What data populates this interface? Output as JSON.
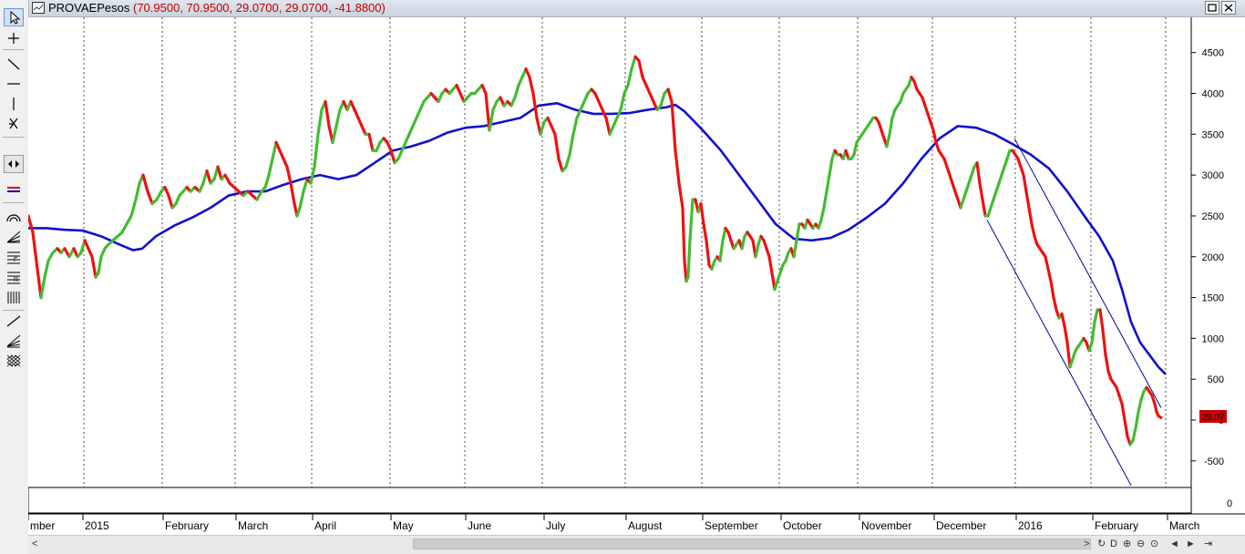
{
  "window": {
    "title": "PROVAEPesos",
    "values": "(70.9500, 70.9500, 29.0700, 29.0700, -41.8800)"
  },
  "toolbar": {
    "tools": [
      "select-tool",
      "crosshair-tool",
      "trendline-tool",
      "horizontal-line-tool",
      "vertical-line-tool",
      "cross-lines-tool",
      "scroll-tool",
      "indicator-tool",
      "arc-tool",
      "fan-tool",
      "fibonacci-tool",
      "fib-retracement-tool",
      "time-cycles-tool",
      "line-tool",
      "speed-lines-tool",
      "grid-tool"
    ]
  },
  "scrollbar": {
    "left_arrow": "<",
    "right_arrow": ">",
    "buttons": [
      "↻",
      "D",
      "⊕",
      "⊖",
      "⊙",
      "◄",
      "►",
      "⇥"
    ]
  },
  "colors": {
    "up": "#44bb33",
    "down": "#ee1111",
    "ma": "#1010cc",
    "channel": "#000099",
    "badge_bg": "#cc0000"
  },
  "chart_data": {
    "type": "line",
    "title": "PROVAEPesos",
    "ylim": [
      -800,
      4950
    ],
    "yticks": [
      4500,
      4000,
      3500,
      3000,
      2500,
      2000,
      1500,
      1000,
      500,
      0,
      -500
    ],
    "subpanel_ytick": "0",
    "last_value_label": "29.07",
    "xticks": [
      "mber",
      "2015",
      "February",
      "March",
      "April",
      "May",
      "June",
      "July",
      "August",
      "September",
      "October",
      "November",
      "December",
      "2016",
      "February",
      "March"
    ],
    "price": [
      [
        0,
        2500
      ],
      [
        5,
        2300
      ],
      [
        10,
        1850
      ],
      [
        14,
        1500
      ],
      [
        18,
        1750
      ],
      [
        22,
        1950
      ],
      [
        27,
        2050
      ],
      [
        32,
        2100
      ],
      [
        36,
        2050
      ],
      [
        40,
        2100
      ],
      [
        45,
        2000
      ],
      [
        50,
        2100
      ],
      [
        54,
        2000
      ],
      [
        58,
        2050
      ],
      [
        62,
        2200
      ],
      [
        66,
        2100
      ],
      [
        70,
        2000
      ],
      [
        74,
        1750
      ],
      [
        77,
        1800
      ],
      [
        80,
        2000
      ],
      [
        84,
        2100
      ],
      [
        88,
        2150
      ],
      [
        93,
        2200
      ],
      [
        98,
        2250
      ],
      [
        103,
        2300
      ],
      [
        108,
        2400
      ],
      [
        113,
        2500
      ],
      [
        118,
        2700
      ],
      [
        122,
        2900
      ],
      [
        126,
        3000
      ],
      [
        131,
        2800
      ],
      [
        136,
        2650
      ],
      [
        141,
        2700
      ],
      [
        146,
        2800
      ],
      [
        150,
        2850
      ],
      [
        154,
        2750
      ],
      [
        158,
        2600
      ],
      [
        162,
        2650
      ],
      [
        166,
        2750
      ],
      [
        170,
        2800
      ],
      [
        174,
        2850
      ],
      [
        178,
        2800
      ],
      [
        183,
        2850
      ],
      [
        188,
        2800
      ],
      [
        192,
        2900
      ],
      [
        196,
        3050
      ],
      [
        200,
        2900
      ],
      [
        204,
        2950
      ],
      [
        208,
        3100
      ],
      [
        212,
        2950
      ],
      [
        216,
        3000
      ],
      [
        221,
        2900
      ],
      [
        226,
        2850
      ],
      [
        231,
        2800
      ],
      [
        236,
        2750
      ],
      [
        241,
        2800
      ],
      [
        246,
        2750
      ],
      [
        251,
        2700
      ],
      [
        256,
        2800
      ],
      [
        260,
        2850
      ],
      [
        264,
        3000
      ],
      [
        268,
        3200
      ],
      [
        272,
        3400
      ],
      [
        276,
        3300
      ],
      [
        280,
        3200
      ],
      [
        284,
        3100
      ],
      [
        288,
        2900
      ],
      [
        292,
        2650
      ],
      [
        295,
        2500
      ],
      [
        298,
        2600
      ],
      [
        302,
        2800
      ],
      [
        306,
        2950
      ],
      [
        310,
        2900
      ],
      [
        314,
        3100
      ],
      [
        318,
        3500
      ],
      [
        322,
        3800
      ],
      [
        326,
        3900
      ],
      [
        330,
        3600
      ],
      [
        334,
        3400
      ],
      [
        338,
        3600
      ],
      [
        342,
        3800
      ],
      [
        346,
        3900
      ],
      [
        350,
        3800
      ],
      [
        354,
        3900
      ],
      [
        358,
        3800
      ],
      [
        362,
        3700
      ],
      [
        366,
        3600
      ],
      [
        370,
        3500
      ],
      [
        374,
        3500
      ],
      [
        378,
        3300
      ],
      [
        382,
        3300
      ],
      [
        386,
        3400
      ],
      [
        390,
        3450
      ],
      [
        394,
        3400
      ],
      [
        398,
        3300
      ],
      [
        402,
        3150
      ],
      [
        406,
        3200
      ],
      [
        410,
        3300
      ],
      [
        414,
        3400
      ],
      [
        418,
        3500
      ],
      [
        422,
        3600
      ],
      [
        426,
        3700
      ],
      [
        430,
        3800
      ],
      [
        434,
        3900
      ],
      [
        438,
        3950
      ],
      [
        442,
        4000
      ],
      [
        446,
        3950
      ],
      [
        450,
        3900
      ],
      [
        454,
        4000
      ],
      [
        458,
        4050
      ],
      [
        462,
        4000
      ],
      [
        466,
        4050
      ],
      [
        470,
        4100
      ],
      [
        474,
        4000
      ],
      [
        478,
        3900
      ],
      [
        482,
        3950
      ],
      [
        486,
        4000
      ],
      [
        490,
        4000
      ],
      [
        494,
        4050
      ],
      [
        498,
        4100
      ],
      [
        502,
        4000
      ],
      [
        506,
        3550
      ],
      [
        510,
        3800
      ],
      [
        514,
        3900
      ],
      [
        518,
        3950
      ],
      [
        522,
        3850
      ],
      [
        526,
        3900
      ],
      [
        530,
        3850
      ],
      [
        534,
        3950
      ],
      [
        538,
        4100
      ],
      [
        542,
        4200
      ],
      [
        546,
        4300
      ],
      [
        550,
        4200
      ],
      [
        554,
        4000
      ],
      [
        558,
        3700
      ],
      [
        562,
        3500
      ],
      [
        566,
        3650
      ],
      [
        570,
        3700
      ],
      [
        574,
        3600
      ],
      [
        578,
        3500
      ],
      [
        582,
        3200
      ],
      [
        586,
        3050
      ],
      [
        590,
        3100
      ],
      [
        594,
        3250
      ],
      [
        598,
        3500
      ],
      [
        602,
        3700
      ],
      [
        606,
        3800
      ],
      [
        610,
        3900
      ],
      [
        614,
        4000
      ],
      [
        618,
        4050
      ],
      [
        622,
        4000
      ],
      [
        626,
        3900
      ],
      [
        630,
        3800
      ],
      [
        634,
        3700
      ],
      [
        638,
        3500
      ],
      [
        642,
        3600
      ],
      [
        646,
        3700
      ],
      [
        650,
        3800
      ],
      [
        654,
        4000
      ],
      [
        658,
        4100
      ],
      [
        662,
        4300
      ],
      [
        666,
        4450
      ],
      [
        670,
        4400
      ],
      [
        674,
        4200
      ],
      [
        678,
        4100
      ],
      [
        682,
        4000
      ],
      [
        686,
        3900
      ],
      [
        690,
        3800
      ],
      [
        694,
        3850
      ],
      [
        698,
        4000
      ],
      [
        702,
        4050
      ],
      [
        706,
        3900
      ],
      [
        710,
        3300
      ],
      [
        714,
        2900
      ],
      [
        718,
        2600
      ],
      [
        720,
        1950
      ],
      [
        722,
        1700
      ],
      [
        724,
        1750
      ],
      [
        726,
        2200
      ],
      [
        729,
        2700
      ],
      [
        732,
        2700
      ],
      [
        735,
        2550
      ],
      [
        738,
        2650
      ],
      [
        741,
        2400
      ],
      [
        744,
        2200
      ],
      [
        747,
        1900
      ],
      [
        750,
        1850
      ],
      [
        753,
        1950
      ],
      [
        756,
        2000
      ],
      [
        759,
        1950
      ],
      [
        762,
        2200
      ],
      [
        765,
        2350
      ],
      [
        768,
        2300
      ],
      [
        771,
        2200
      ],
      [
        774,
        2100
      ],
      [
        777,
        2150
      ],
      [
        780,
        2200
      ],
      [
        783,
        2100
      ],
      [
        786,
        2250
      ],
      [
        789,
        2300
      ],
      [
        792,
        2250
      ],
      [
        795,
        2200
      ],
      [
        798,
        2000
      ],
      [
        801,
        2150
      ],
      [
        804,
        2250
      ],
      [
        807,
        2200
      ],
      [
        810,
        2100
      ],
      [
        813,
        2000
      ],
      [
        816,
        1800
      ],
      [
        819,
        1600
      ],
      [
        822,
        1700
      ],
      [
        825,
        1800
      ],
      [
        828,
        1900
      ],
      [
        831,
        1950
      ],
      [
        834,
        2050
      ],
      [
        837,
        2100
      ],
      [
        840,
        2000
      ],
      [
        843,
        2200
      ],
      [
        846,
        2400
      ],
      [
        849,
        2400
      ],
      [
        852,
        2350
      ],
      [
        855,
        2450
      ],
      [
        858,
        2400
      ],
      [
        861,
        2350
      ],
      [
        864,
        2400
      ],
      [
        867,
        2350
      ],
      [
        870,
        2450
      ],
      [
        873,
        2600
      ],
      [
        876,
        2800
      ],
      [
        879,
        3000
      ],
      [
        882,
        3200
      ],
      [
        885,
        3300
      ],
      [
        888,
        3250
      ],
      [
        891,
        3250
      ],
      [
        894,
        3200
      ],
      [
        897,
        3300
      ],
      [
        900,
        3200
      ],
      [
        903,
        3200
      ],
      [
        906,
        3250
      ],
      [
        909,
        3400
      ],
      [
        912,
        3450
      ],
      [
        915,
        3500
      ],
      [
        918,
        3550
      ],
      [
        921,
        3600
      ],
      [
        924,
        3650
      ],
      [
        927,
        3700
      ],
      [
        930,
        3700
      ],
      [
        933,
        3650
      ],
      [
        936,
        3550
      ],
      [
        939,
        3450
      ],
      [
        942,
        3350
      ],
      [
        945,
        3500
      ],
      [
        948,
        3700
      ],
      [
        951,
        3800
      ],
      [
        954,
        3850
      ],
      [
        957,
        3900
      ],
      [
        960,
        4000
      ],
      [
        963,
        4050
      ],
      [
        966,
        4100
      ],
      [
        969,
        4200
      ],
      [
        972,
        4150
      ],
      [
        975,
        4050
      ],
      [
        978,
        4000
      ],
      [
        981,
        3950
      ],
      [
        984,
        3850
      ],
      [
        987,
        3750
      ],
      [
        990,
        3650
      ],
      [
        993,
        3550
      ],
      [
        996,
        3400
      ],
      [
        999,
        3300
      ],
      [
        1002,
        3250
      ],
      [
        1005,
        3200
      ],
      [
        1008,
        3100
      ],
      [
        1011,
        3000
      ],
      [
        1014,
        2900
      ],
      [
        1017,
        2800
      ],
      [
        1020,
        2700
      ],
      [
        1023,
        2600
      ],
      [
        1026,
        2700
      ],
      [
        1029,
        2800
      ],
      [
        1032,
        2900
      ],
      [
        1035,
        3000
      ],
      [
        1038,
        3100
      ],
      [
        1041,
        3150
      ],
      [
        1044,
        2900
      ],
      [
        1047,
        2700
      ],
      [
        1050,
        2500
      ],
      [
        1053,
        2500
      ],
      [
        1056,
        2600
      ],
      [
        1059,
        2700
      ],
      [
        1062,
        2800
      ],
      [
        1065,
        2900
      ],
      [
        1068,
        3000
      ],
      [
        1071,
        3100
      ],
      [
        1074,
        3200
      ],
      [
        1077,
        3300
      ],
      [
        1080,
        3300
      ],
      [
        1083,
        3250
      ],
      [
        1086,
        3200
      ],
      [
        1089,
        3100
      ],
      [
        1092,
        3000
      ],
      [
        1095,
        2800
      ],
      [
        1098,
        2600
      ],
      [
        1101,
        2400
      ],
      [
        1104,
        2250
      ],
      [
        1107,
        2150
      ],
      [
        1110,
        2100
      ],
      [
        1113,
        2050
      ],
      [
        1116,
        2000
      ],
      [
        1119,
        1850
      ],
      [
        1122,
        1700
      ],
      [
        1125,
        1500
      ],
      [
        1128,
        1350
      ],
      [
        1131,
        1250
      ],
      [
        1134,
        1300
      ],
      [
        1137,
        1150
      ],
      [
        1140,
        950
      ],
      [
        1143,
        650
      ],
      [
        1146,
        750
      ],
      [
        1149,
        850
      ],
      [
        1152,
        900
      ],
      [
        1155,
        950
      ],
      [
        1158,
        1000
      ],
      [
        1161,
        950
      ],
      [
        1164,
        850
      ],
      [
        1167,
        950
      ],
      [
        1170,
        1200
      ],
      [
        1173,
        1350
      ],
      [
        1176,
        1350
      ],
      [
        1179,
        1100
      ],
      [
        1182,
        800
      ],
      [
        1185,
        600
      ],
      [
        1188,
        500
      ],
      [
        1191,
        450
      ],
      [
        1194,
        400
      ],
      [
        1197,
        300
      ],
      [
        1200,
        200
      ],
      [
        1203,
        0
      ],
      [
        1206,
        -200
      ],
      [
        1209,
        -300
      ],
      [
        1212,
        -250
      ],
      [
        1215,
        -100
      ],
      [
        1218,
        100
      ],
      [
        1221,
        250
      ],
      [
        1224,
        350
      ],
      [
        1227,
        400
      ],
      [
        1230,
        350
      ],
      [
        1233,
        300
      ],
      [
        1236,
        200
      ],
      [
        1238,
        100
      ],
      [
        1240,
        50
      ],
      [
        1243,
        29
      ]
    ],
    "moving_average": [
      [
        0,
        2350
      ],
      [
        20,
        2350
      ],
      [
        40,
        2330
      ],
      [
        60,
        2320
      ],
      [
        80,
        2250
      ],
      [
        100,
        2150
      ],
      [
        115,
        2080
      ],
      [
        125,
        2100
      ],
      [
        140,
        2250
      ],
      [
        160,
        2380
      ],
      [
        180,
        2480
      ],
      [
        200,
        2600
      ],
      [
        220,
        2750
      ],
      [
        240,
        2800
      ],
      [
        260,
        2800
      ],
      [
        280,
        2880
      ],
      [
        300,
        2950
      ],
      [
        320,
        3000
      ],
      [
        340,
        2950
      ],
      [
        360,
        3000
      ],
      [
        380,
        3150
      ],
      [
        400,
        3300
      ],
      [
        420,
        3350
      ],
      [
        440,
        3420
      ],
      [
        460,
        3520
      ],
      [
        480,
        3580
      ],
      [
        500,
        3600
      ],
      [
        520,
        3650
      ],
      [
        540,
        3700
      ],
      [
        560,
        3850
      ],
      [
        580,
        3880
      ],
      [
        600,
        3800
      ],
      [
        620,
        3750
      ],
      [
        640,
        3750
      ],
      [
        660,
        3760
      ],
      [
        680,
        3800
      ],
      [
        700,
        3830
      ],
      [
        710,
        3860
      ],
      [
        720,
        3780
      ],
      [
        740,
        3550
      ],
      [
        760,
        3300
      ],
      [
        780,
        3000
      ],
      [
        800,
        2700
      ],
      [
        820,
        2400
      ],
      [
        840,
        2220
      ],
      [
        860,
        2200
      ],
      [
        880,
        2230
      ],
      [
        900,
        2330
      ],
      [
        920,
        2480
      ],
      [
        940,
        2650
      ],
      [
        960,
        2900
      ],
      [
        980,
        3200
      ],
      [
        1000,
        3450
      ],
      [
        1020,
        3600
      ],
      [
        1040,
        3580
      ],
      [
        1060,
        3500
      ],
      [
        1080,
        3380
      ],
      [
        1100,
        3250
      ],
      [
        1120,
        3080
      ],
      [
        1140,
        2800
      ],
      [
        1160,
        2480
      ],
      [
        1175,
        2250
      ],
      [
        1190,
        1950
      ],
      [
        1200,
        1600
      ],
      [
        1210,
        1200
      ],
      [
        1220,
        950
      ],
      [
        1230,
        800
      ],
      [
        1240,
        650
      ],
      [
        1248,
        560
      ]
    ],
    "channel_upper": [
      [
        1082,
        3450
      ],
      [
        1243,
        150
      ]
    ],
    "channel_lower": [
      [
        1052,
        2450
      ],
      [
        1210,
        -800
      ]
    ]
  }
}
